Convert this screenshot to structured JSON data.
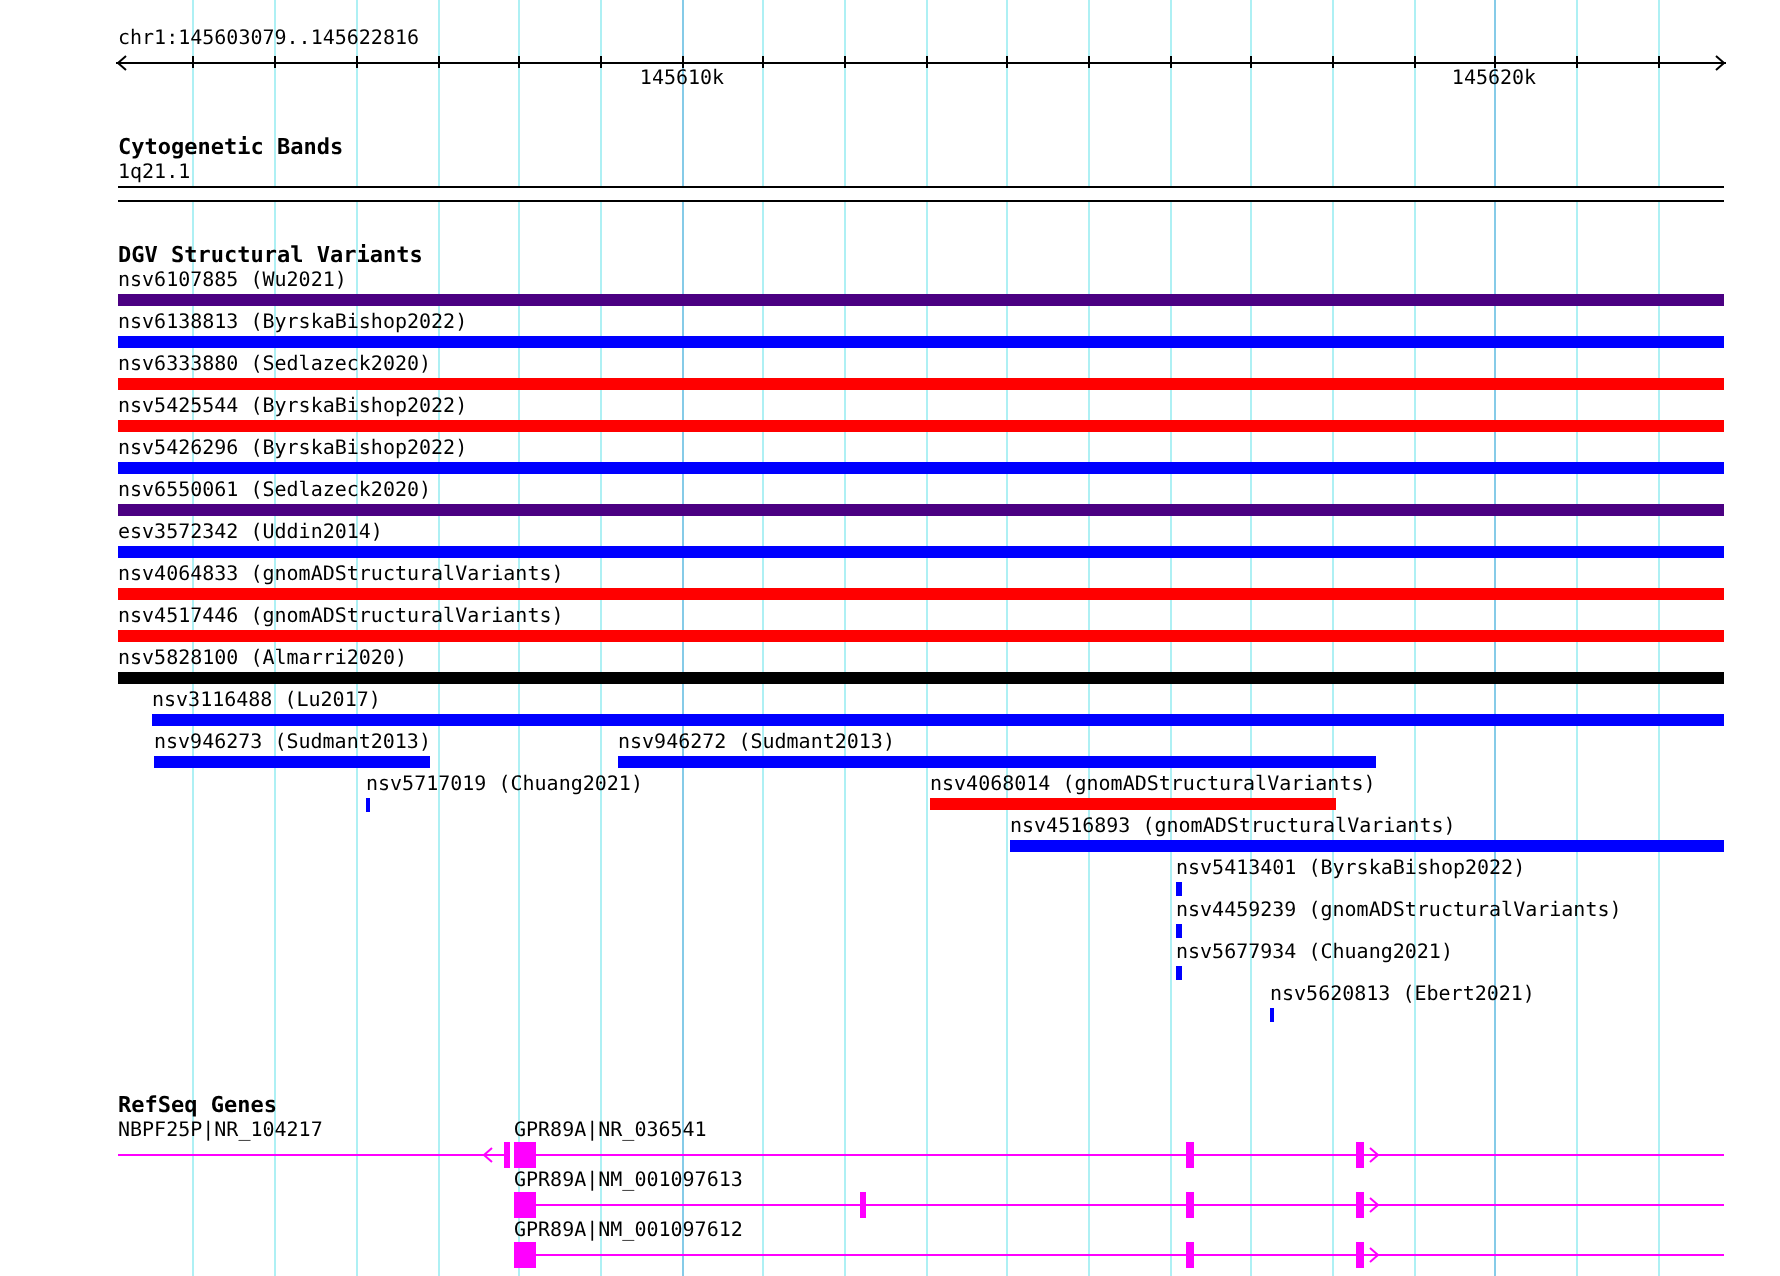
{
  "location": "chr1:145603079..145622816",
  "scale_labels": [
    "145610k",
    "145620k"
  ],
  "tracks": [
    {
      "kind": "cytoband",
      "title": "Cytogenetic Bands",
      "bands": [
        {
          "name": "1q21.1"
        }
      ]
    },
    {
      "kind": "variants",
      "title": "DGV Structural Variants",
      "rows": [
        [
          {
            "label": "nsv6107885 (Wu2021)",
            "color": "#4b0082"
          }
        ],
        [
          {
            "label": "nsv6138813 (ByrskaBishop2022)",
            "color": "#0000ff"
          }
        ],
        [
          {
            "label": "nsv6333880 (Sedlazeck2020)",
            "color": "#ff0000"
          }
        ],
        [
          {
            "label": "nsv5425544 (ByrskaBishop2022)",
            "color": "#ff0000"
          }
        ],
        [
          {
            "label": "nsv5426296 (ByrskaBishop2022)",
            "color": "#0000ff"
          }
        ],
        [
          {
            "label": "nsv6550061 (Sedlazeck2020)",
            "color": "#4b0082"
          }
        ],
        [
          {
            "label": "esv3572342 (Uddin2014)",
            "color": "#0000ff"
          }
        ],
        [
          {
            "label": "nsv4064833 (gnomADStructuralVariants)",
            "color": "#ff0000"
          }
        ],
        [
          {
            "label": "nsv4517446 (gnomADStructuralVariants)",
            "color": "#ff0000"
          }
        ],
        [
          {
            "label": "nsv5828100 (Almarri2020)",
            "color": "#000000"
          }
        ],
        [
          {
            "label": "nsv3116488 (Lu2017)",
            "color": "#0000ff"
          }
        ],
        [
          {
            "label": "nsv946273 (Sudmant2013)",
            "color": "#0000ff"
          },
          {
            "label": "nsv946272 (Sudmant2013)",
            "color": "#0000ff"
          }
        ],
        [
          {
            "label": "nsv5717019 (Chuang2021)",
            "color": "#0000ff"
          },
          {
            "label": "nsv4068014 (gnomADStructuralVariants)",
            "color": "#ff0000"
          }
        ],
        [
          {
            "label": "nsv4516893 (gnomADStructuralVariants)",
            "color": "#0000ff"
          }
        ],
        [
          {
            "label": "nsv5413401 (ByrskaBishop2022)",
            "color": "#0000ff"
          }
        ],
        [
          {
            "label": "nsv4459239 (gnomADStructuralVariants)",
            "color": "#0000ff"
          }
        ],
        [
          {
            "label": "nsv5677934 (Chuang2021)",
            "color": "#0000ff"
          }
        ],
        [
          {
            "label": "nsv5620813 (Ebert2021)",
            "color": "#0000ff"
          }
        ]
      ]
    },
    {
      "kind": "genes",
      "title": "RefSeq Genes",
      "rows": [
        [
          {
            "label": "NBPF25P|NR_104217",
            "reverse": true
          },
          {
            "label": "GPR89A|NR_036541",
            "reverse": false
          }
        ],
        [
          {
            "label": "GPR89A|NM_001097613",
            "reverse": false
          }
        ],
        [
          {
            "label": "GPR89A|NM_001097612",
            "reverse": false
          }
        ]
      ]
    }
  ]
}
